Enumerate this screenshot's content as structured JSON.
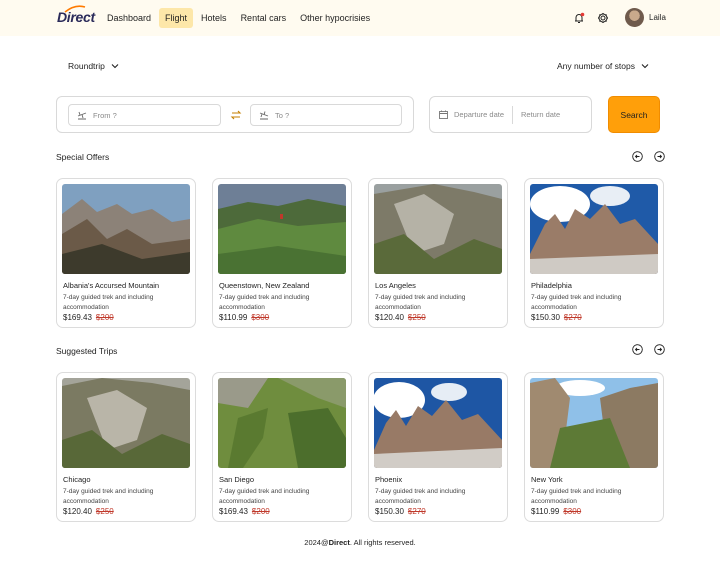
{
  "header": {
    "logo": "Direct",
    "nav": [
      "Dashboard",
      "Flight",
      "Hotels",
      "Rental cars",
      "Other hypocrisies"
    ],
    "active_nav": "Flight",
    "username": "Laila"
  },
  "filters": {
    "trip_type": "Roundtrip",
    "stops": "Any number of stops"
  },
  "search": {
    "from_placeholder": "From ?",
    "to_placeholder": "To ?",
    "departure_placeholder": "Departure date",
    "return_placeholder": "Return date",
    "button": "Search"
  },
  "special_offers": {
    "title": "Special Offers",
    "cards": [
      {
        "title": "Albania's Accursed Mountain",
        "desc": "7-day guided trek and including accommodation",
        "price": "$169.43",
        "old_price": "$200"
      },
      {
        "title": "Queenstown, New Zealand",
        "desc": "7-day guided trek and including accommodation",
        "price": "$110.99",
        "old_price": "$300"
      },
      {
        "title": "Los Angeles",
        "desc": "7-day guided trek and including accommodation",
        "price": "$120.40",
        "old_price": "$250"
      },
      {
        "title": "Philadelphia",
        "desc": "7-day guided trek and including accommodation",
        "price": "$150.30",
        "old_price": "$270"
      }
    ]
  },
  "suggested_trips": {
    "title": "Suggested Trips",
    "cards": [
      {
        "title": "Chicago",
        "desc": "7-day guided trek and including accommodation",
        "price": "$120.40",
        "old_price": "$250"
      },
      {
        "title": "San Diego",
        "desc": "7-day guided trek and including accommodation",
        "price": "$169.43",
        "old_price": "$200"
      },
      {
        "title": "Phoenix",
        "desc": "7-day guided trek and including accommodation",
        "price": "$150.30",
        "old_price": "$270"
      },
      {
        "title": "New York",
        "desc": "7-day guided trek and including accommodation",
        "price": "$110.99",
        "old_price": "$300"
      }
    ]
  },
  "footer": {
    "year": "2024@",
    "brand": "Direct",
    "rights": ". All rights reserved."
  },
  "colors": {
    "accent": "#ff9f0a",
    "active_nav_bg": "#fde7a9",
    "header_bg": "#fffbf0",
    "old_price": "#c0392b"
  },
  "icons": [
    "bell-icon",
    "gear-icon",
    "chevron-down-icon",
    "plane-takeoff-icon",
    "plane-landing-icon",
    "swap-icon",
    "calendar-icon",
    "arrow-left-icon",
    "arrow-right-icon"
  ]
}
